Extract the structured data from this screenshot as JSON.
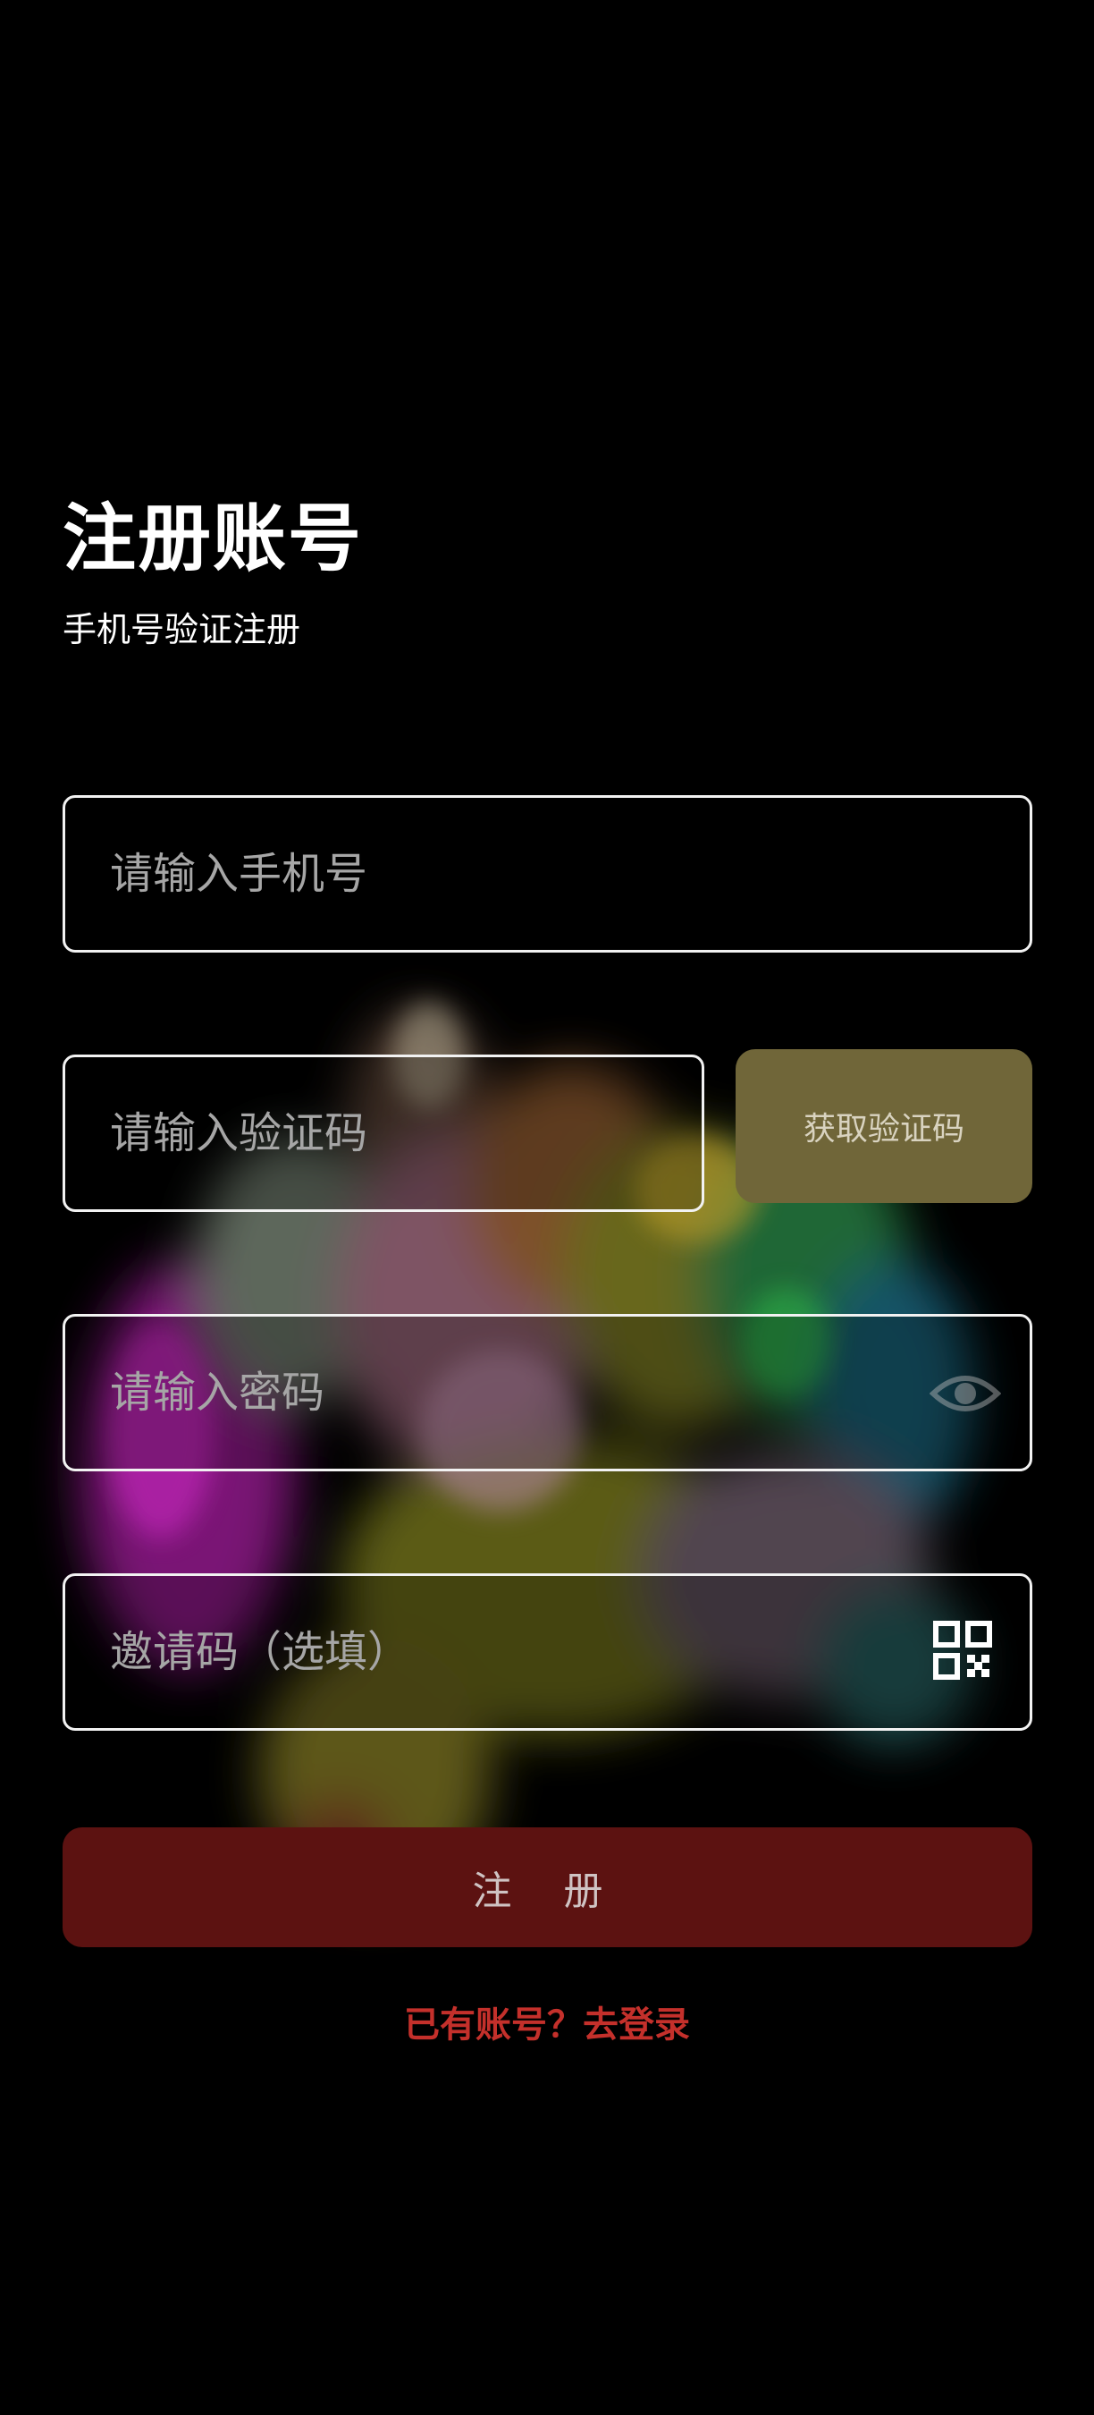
{
  "header": {
    "title": "注册账号",
    "subtitle": "手机号验证注册"
  },
  "form": {
    "phone_placeholder": "请输入手机号",
    "code_placeholder": "请输入验证码",
    "get_code_label": "获取验证码",
    "password_placeholder": "请输入密码",
    "invite_placeholder": "邀请码（选填）"
  },
  "icons": {
    "password_toggle": "eye-icon",
    "invite_scan": "qr-code-icon"
  },
  "actions": {
    "register_label": "注 册",
    "login_link": "已有账号？去登录"
  },
  "colors": {
    "background": "#000000",
    "get_code_button": "#706639",
    "register_button": "#5c1211",
    "login_link": "#c4302b"
  }
}
